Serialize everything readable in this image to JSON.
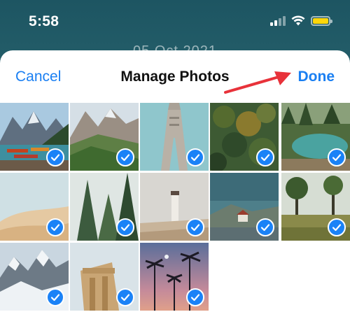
{
  "status_bar": {
    "time": "5:58",
    "icons": [
      "cellular-signal-icon",
      "wifi-icon",
      "battery-icon"
    ],
    "battery_color": "#ffd60a"
  },
  "background": {
    "date_text": "05 Oct 2021"
  },
  "sheet": {
    "cancel_label": "Cancel",
    "title": "Manage Photos",
    "done_label": "Done",
    "accent_color": "#1a7ff2",
    "annotation_arrow_color": "#e8323a"
  },
  "photos": [
    {
      "subject": "mountain lake with canoes",
      "selected": true
    },
    {
      "subject": "rocky mountain valley",
      "selected": true
    },
    {
      "subject": "tower monument",
      "selected": true
    },
    {
      "subject": "autumn forest",
      "selected": true
    },
    {
      "subject": "forest lake",
      "selected": true
    },
    {
      "subject": "sand dune",
      "selected": true
    },
    {
      "subject": "pine trees",
      "selected": true
    },
    {
      "subject": "lighthouse in fog",
      "selected": true
    },
    {
      "subject": "coastal village",
      "selected": true
    },
    {
      "subject": "grassland trees",
      "selected": true
    },
    {
      "subject": "snowy mountains",
      "selected": true
    },
    {
      "subject": "ancient ruins",
      "selected": true
    },
    {
      "subject": "palm trees at dusk",
      "selected": true
    }
  ]
}
